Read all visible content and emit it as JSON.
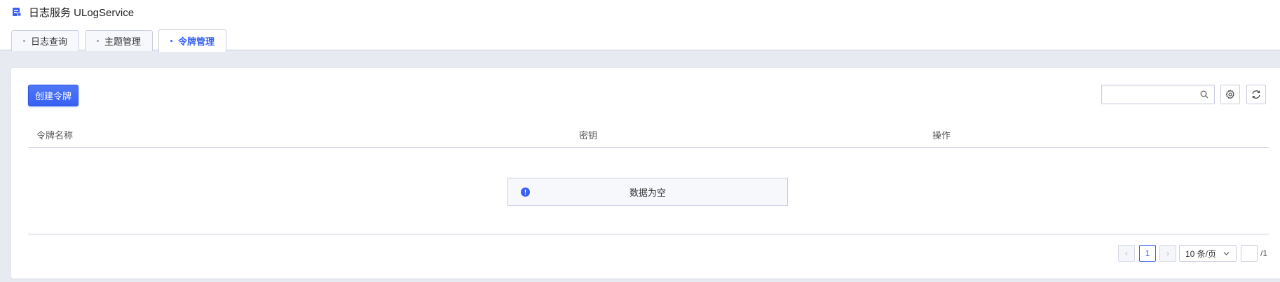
{
  "app": {
    "title": "日志服务 ULogService",
    "icon": "log-service-icon"
  },
  "tabs": [
    {
      "label": "日志查询",
      "active": false
    },
    {
      "label": "主题管理",
      "active": false
    },
    {
      "label": "令牌管理",
      "active": true
    }
  ],
  "toolbar": {
    "create_label": "创建令牌",
    "search_value": "",
    "search_placeholder": "",
    "settings_icon": "gear-icon",
    "refresh_icon": "refresh-icon"
  },
  "table": {
    "columns": [
      "令牌名称",
      "密钥",
      "操作"
    ],
    "rows": [],
    "empty_text": "数据为空"
  },
  "pagination": {
    "prev": "‹",
    "next": "›",
    "current_page": "1",
    "page_size": "10 条/页",
    "jump_value": "",
    "total": "/1"
  },
  "colors": {
    "accent": "#3860f4",
    "border": "#c9cde0",
    "background": "#e8eaf2"
  }
}
